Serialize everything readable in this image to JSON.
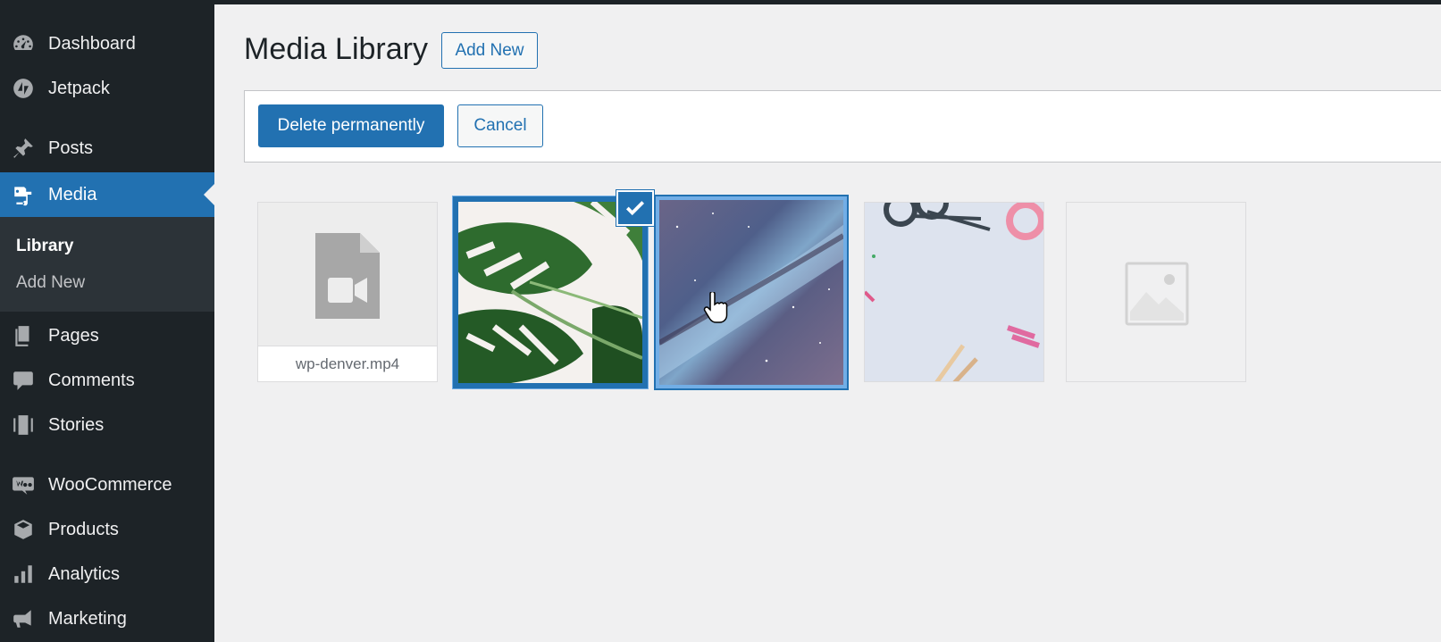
{
  "sidebar": {
    "items": [
      {
        "label": "Dashboard",
        "icon": "dashboard-icon"
      },
      {
        "label": "Jetpack",
        "icon": "jetpack-icon"
      },
      {
        "label": "Posts",
        "icon": "pushpin-icon"
      },
      {
        "label": "Media",
        "icon": "media-icon",
        "active": true
      },
      {
        "label": "Pages",
        "icon": "pages-icon"
      },
      {
        "label": "Comments",
        "icon": "comment-icon"
      },
      {
        "label": "Stories",
        "icon": "stories-icon"
      },
      {
        "label": "WooCommerce",
        "icon": "woocommerce-icon"
      },
      {
        "label": "Products",
        "icon": "products-box-icon"
      },
      {
        "label": "Analytics",
        "icon": "bar-chart-icon"
      },
      {
        "label": "Marketing",
        "icon": "megaphone-icon"
      }
    ],
    "submenu": [
      {
        "label": "Library",
        "current": true
      },
      {
        "label": "Add New"
      }
    ]
  },
  "header": {
    "title": "Media Library",
    "add_new_label": "Add New"
  },
  "toolbar": {
    "delete_label": "Delete permanently",
    "cancel_label": "Cancel"
  },
  "attachments": [
    {
      "type": "video",
      "filename": "wp-denver.mp4",
      "selected": false
    },
    {
      "type": "image",
      "subject": "monstera leaves",
      "selected": true
    },
    {
      "type": "image",
      "subject": "milky way night sky",
      "selected": false,
      "focused": true
    },
    {
      "type": "image",
      "subject": "scissors and craft supplies",
      "selected": false
    },
    {
      "type": "image",
      "subject": "placeholder",
      "selected": false
    }
  ],
  "colors": {
    "sidebar_bg": "#1d2327",
    "accent": "#2271b1",
    "page_bg": "#f0f0f1"
  }
}
